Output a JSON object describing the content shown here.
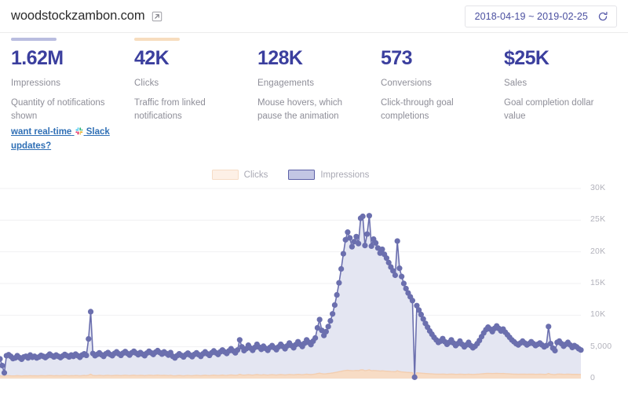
{
  "header": {
    "site_title": "woodstockzambon.com",
    "external_link_icon": "external-link-icon",
    "date_range": "2018-04-19 ~ 2019-02-25",
    "refresh_icon": "refresh-icon"
  },
  "kpis": [
    {
      "value": "1.62M",
      "label": "Impressions",
      "description": "Quantity of notifications shown",
      "accent": "#b9bde0"
    },
    {
      "value": "42K",
      "label": "Clicks",
      "description": "Traffic from linked notifications",
      "accent": "#f7ddbe"
    },
    {
      "value": "128K",
      "label": "Engagements",
      "description": "Mouse hovers, which pause the animation",
      "accent": ""
    },
    {
      "value": "573",
      "label": "Conversions",
      "description": "Click-through goal completions",
      "accent": ""
    },
    {
      "value": "$25K",
      "label": "Sales",
      "description": "Goal completion dollar value",
      "accent": ""
    }
  ],
  "slack_promo": {
    "text_before": "want real-time",
    "text_after": "Slack updates?",
    "icon": "slack-icon"
  },
  "colors": {
    "kpi_value": "#3b3f9e",
    "impressions_line": "#6b6fae",
    "impressions_fill": "#e4e6f2",
    "clicks_line": "#f3ceb0",
    "clicks_fill": "#f7dcc5",
    "grid": "#f0f0f3",
    "link": "#2f6fb5"
  },
  "chart_data": {
    "type": "area",
    "title": "",
    "xlabel": "",
    "ylabel": "",
    "ylim": [
      0,
      30000
    ],
    "grid": true,
    "legend_position": "top-center",
    "ytick_labels": [
      "30K",
      "25K",
      "20K",
      "15K",
      "10K",
      "5,000",
      "0"
    ],
    "ytick_values": [
      30000,
      25000,
      20000,
      15000,
      10000,
      5000,
      0
    ],
    "x_range": "2018-04-19 to 2019-02-25",
    "series": [
      {
        "name": "Impressions",
        "color": "#6b6fae",
        "fill": "#e4e6f2",
        "markers": true,
        "values": [
          3100,
          2050,
          900,
          3600,
          3750,
          3500,
          3150,
          3250,
          3600,
          3300,
          3050,
          3400,
          3500,
          3250,
          3700,
          3350,
          3500,
          3250,
          3400,
          3650,
          3500,
          3300,
          3550,
          3850,
          3600,
          3400,
          3700,
          3500,
          3300,
          3550,
          3800,
          3600,
          3400,
          3700,
          3500,
          3850,
          3600,
          3350,
          3700,
          3900,
          3650,
          6250,
          10550,
          3950,
          3600,
          3800,
          4050,
          3750,
          3500,
          3900,
          4100,
          3800,
          3600,
          3950,
          4200,
          3900,
          3650,
          4000,
          4250,
          3950,
          3700,
          4050,
          4300,
          4000,
          3750,
          4100,
          3850,
          3600,
          4000,
          4300,
          4050,
          3800,
          4150,
          4400,
          4100,
          3850,
          4200,
          3950,
          3700,
          4100,
          3500,
          3250,
          3600,
          3900,
          3650,
          3400,
          3750,
          4000,
          3700,
          3450,
          3800,
          4050,
          3750,
          3500,
          3900,
          4200,
          3900,
          3650,
          4050,
          4350,
          4050,
          3800,
          4200,
          4500,
          4200,
          3950,
          4350,
          4700,
          4350,
          4050,
          4500,
          6100,
          5000,
          4400,
          4700,
          5250,
          4800,
          4450,
          4900,
          5400,
          4950,
          4600,
          5100,
          4750,
          4450,
          4900,
          5200,
          4850,
          4550,
          5000,
          5400,
          5050,
          4700,
          5150,
          5600,
          5200,
          4850,
          5350,
          5800,
          5400,
          5050,
          5550,
          6100,
          5700,
          5350,
          5900,
          6400,
          8000,
          9300,
          7600,
          6800,
          7400,
          8200,
          9100,
          10200,
          11600,
          13200,
          15100,
          17300,
          19700,
          21900,
          23100,
          22200,
          20800,
          21600,
          22400,
          21300,
          25300,
          25600,
          21000,
          22800,
          25700,
          20900,
          22000,
          21400,
          20600,
          19800,
          20400,
          19600,
          19000,
          18300,
          17600,
          17000,
          16300,
          21700,
          17400,
          16100,
          15000,
          14200,
          13500,
          12900,
          12300,
          200,
          11500,
          10800,
          10100,
          9400,
          8700,
          8100,
          7500,
          7000,
          6500,
          6100,
          5700,
          5900,
          6300,
          5800,
          5400,
          5700,
          6100,
          5600,
          5200,
          5500,
          5900,
          5400,
          5000,
          5300,
          5700,
          5200,
          4850,
          5100,
          5500,
          6000,
          6600,
          7200,
          7700,
          8100,
          7800,
          7400,
          7900,
          8300,
          7900,
          7500,
          7800,
          7300,
          6900,
          6500,
          6100,
          5800,
          5500,
          5300,
          5600,
          5900,
          5600,
          5300,
          5500,
          5800,
          5500,
          5200,
          5400,
          5600,
          5300,
          5000,
          5200,
          8200,
          5500,
          4800,
          4400,
          5700,
          5900,
          5500,
          5100,
          5400,
          5700,
          5300,
          4900,
          5200,
          5000,
          4700,
          4500
        ]
      },
      {
        "name": "Clicks",
        "color": "#f3ceb0",
        "fill": "#f7dcc5",
        "markers": false,
        "values": [
          420,
          400,
          380,
          440,
          460,
          430,
          410,
          420,
          450,
          430,
          400,
          430,
          440,
          420,
          460,
          430,
          440,
          420,
          430,
          460,
          440,
          420,
          450,
          470,
          450,
          430,
          460,
          440,
          420,
          450,
          470,
          450,
          430,
          460,
          440,
          470,
          450,
          430,
          460,
          480,
          450,
          520,
          680,
          490,
          450,
          470,
          500,
          470,
          440,
          480,
          500,
          470,
          450,
          490,
          510,
          480,
          460,
          490,
          520,
          490,
          460,
          500,
          520,
          490,
          470,
          500,
          480,
          450,
          490,
          520,
          500,
          470,
          510,
          530,
          500,
          480,
          510,
          490,
          460,
          500,
          440,
          420,
          450,
          480,
          450,
          430,
          460,
          490,
          460,
          440,
          470,
          500,
          470,
          440,
          480,
          510,
          480,
          460,
          500,
          530,
          500,
          470,
          510,
          540,
          510,
          490,
          530,
          560,
          530,
          500,
          540,
          650,
          570,
          530,
          560,
          600,
          570,
          540,
          580,
          620,
          580,
          550,
          600,
          570,
          540,
          580,
          610,
          580,
          550,
          590,
          620,
          590,
          560,
          600,
          640,
          610,
          580,
          620,
          660,
          630,
          600,
          640,
          680,
          650,
          620,
          660,
          700,
          780,
          840,
          760,
          720,
          750,
          790,
          830,
          880,
          940,
          1000,
          1070,
          1140,
          1210,
          1270,
          1300,
          1270,
          1230,
          1250,
          1280,
          1240,
          1360,
          1370,
          1230,
          1290,
          1370,
          1230,
          1260,
          1240,
          1220,
          1190,
          1210,
          1180,
          1160,
          1140,
          1110,
          1090,
          1070,
          1230,
          1090,
          1050,
          1020,
          990,
          960,
          940,
          920,
          180,
          900,
          870,
          850,
          820,
          790,
          770,
          750,
          730,
          710,
          690,
          680,
          690,
          700,
          680,
          660,
          680,
          700,
          680,
          660,
          670,
          690,
          670,
          650,
          660,
          680,
          660,
          640,
          660,
          680,
          700,
          730,
          760,
          790,
          810,
          800,
          780,
          800,
          820,
          800,
          780,
          800,
          770,
          750,
          730,
          710,
          690,
          680,
          670,
          680,
          690,
          680,
          670,
          680,
          690,
          680,
          660,
          670,
          680,
          670,
          650,
          660,
          790,
          670,
          640,
          620,
          690,
          700,
          680,
          660,
          670,
          690,
          670,
          650,
          660,
          650,
          640,
          630
        ]
      }
    ]
  }
}
